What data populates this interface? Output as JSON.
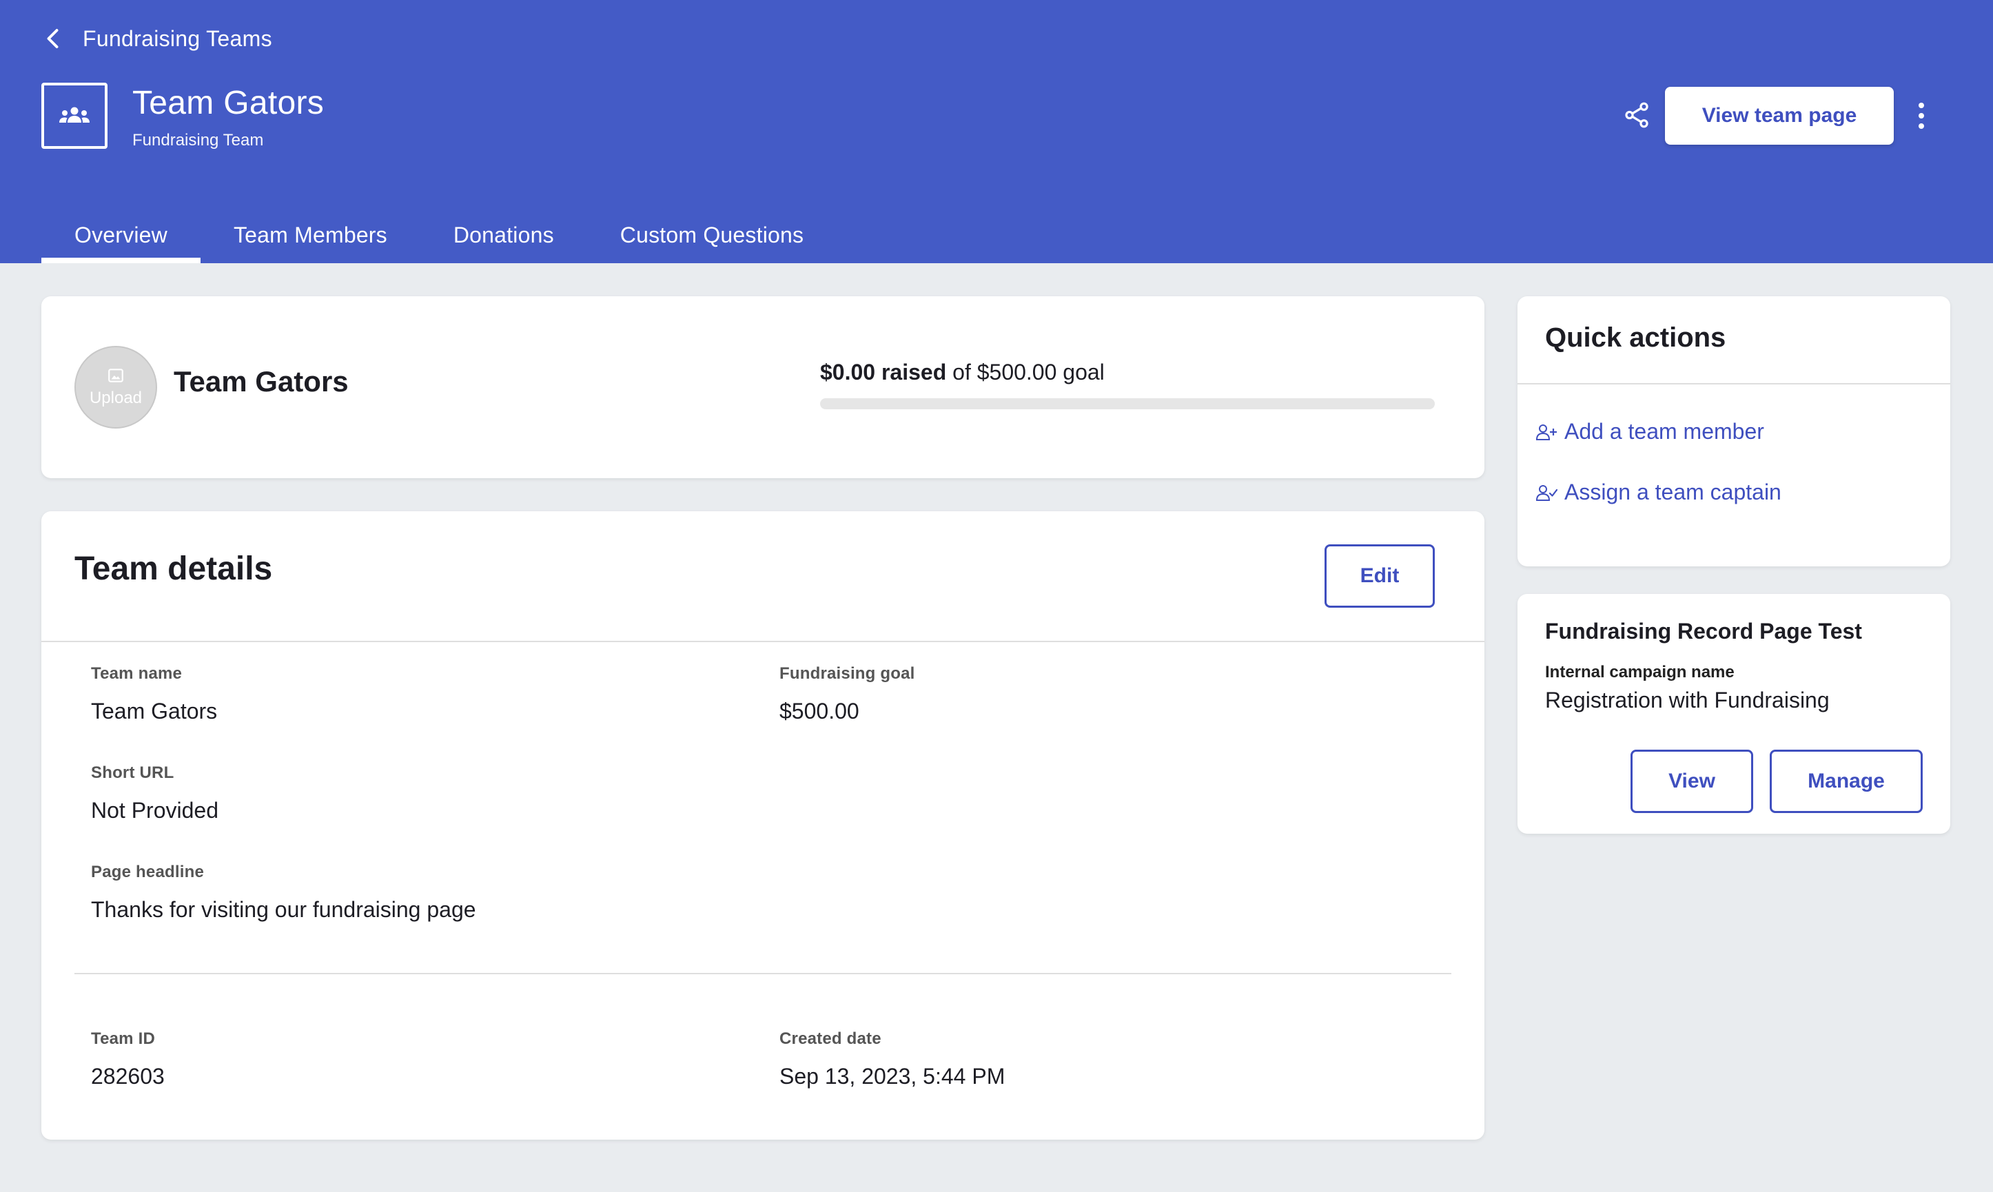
{
  "header": {
    "back_label": "Fundraising Teams",
    "title": "Team Gators",
    "subtitle": "Fundraising Team",
    "view_team_page_label": "View team page",
    "bg_color": "#445bc6",
    "icons": {
      "back": "chevron-left-icon",
      "team": "team-group-icon",
      "share": "share-icon",
      "more": "more-vertical-icon"
    }
  },
  "tabs": [
    {
      "label": "Overview",
      "active": true
    },
    {
      "label": "Team Members",
      "active": false
    },
    {
      "label": "Donations",
      "active": false
    },
    {
      "label": "Custom Questions",
      "active": false
    }
  ],
  "summary": {
    "upload_label": "Upload",
    "team_name": "Team Gators",
    "raised_amount": "$0.00 raised",
    "goal_text": "of $500.00 goal",
    "progress_fraction": 0
  },
  "details": {
    "title": "Team details",
    "edit_label": "Edit",
    "fields": {
      "team_name": {
        "label": "Team name",
        "value": "Team Gators"
      },
      "fundraising_goal": {
        "label": "Fundraising goal",
        "value": "$500.00"
      },
      "short_url": {
        "label": "Short URL",
        "value": "Not Provided"
      },
      "page_headline": {
        "label": "Page headline",
        "value": "Thanks for visiting our fundraising page"
      },
      "team_id": {
        "label": "Team ID",
        "value": "282603"
      },
      "created_date": {
        "label": "Created date",
        "value": "Sep 13, 2023, 5:44 PM"
      }
    }
  },
  "quick_actions": {
    "title": "Quick actions",
    "items": [
      {
        "label": "Add a team member",
        "icon": "person-add-icon"
      },
      {
        "label": "Assign a team captain",
        "icon": "person-check-icon"
      }
    ]
  },
  "campaign": {
    "title": "Fundraising Record Page Test",
    "internal_label": "Internal campaign name",
    "internal_value": "Registration with Fundraising",
    "view_label": "View",
    "manage_label": "Manage"
  },
  "colors": {
    "accent": "#3f4fbf",
    "page_bg": "#e9ecef"
  }
}
